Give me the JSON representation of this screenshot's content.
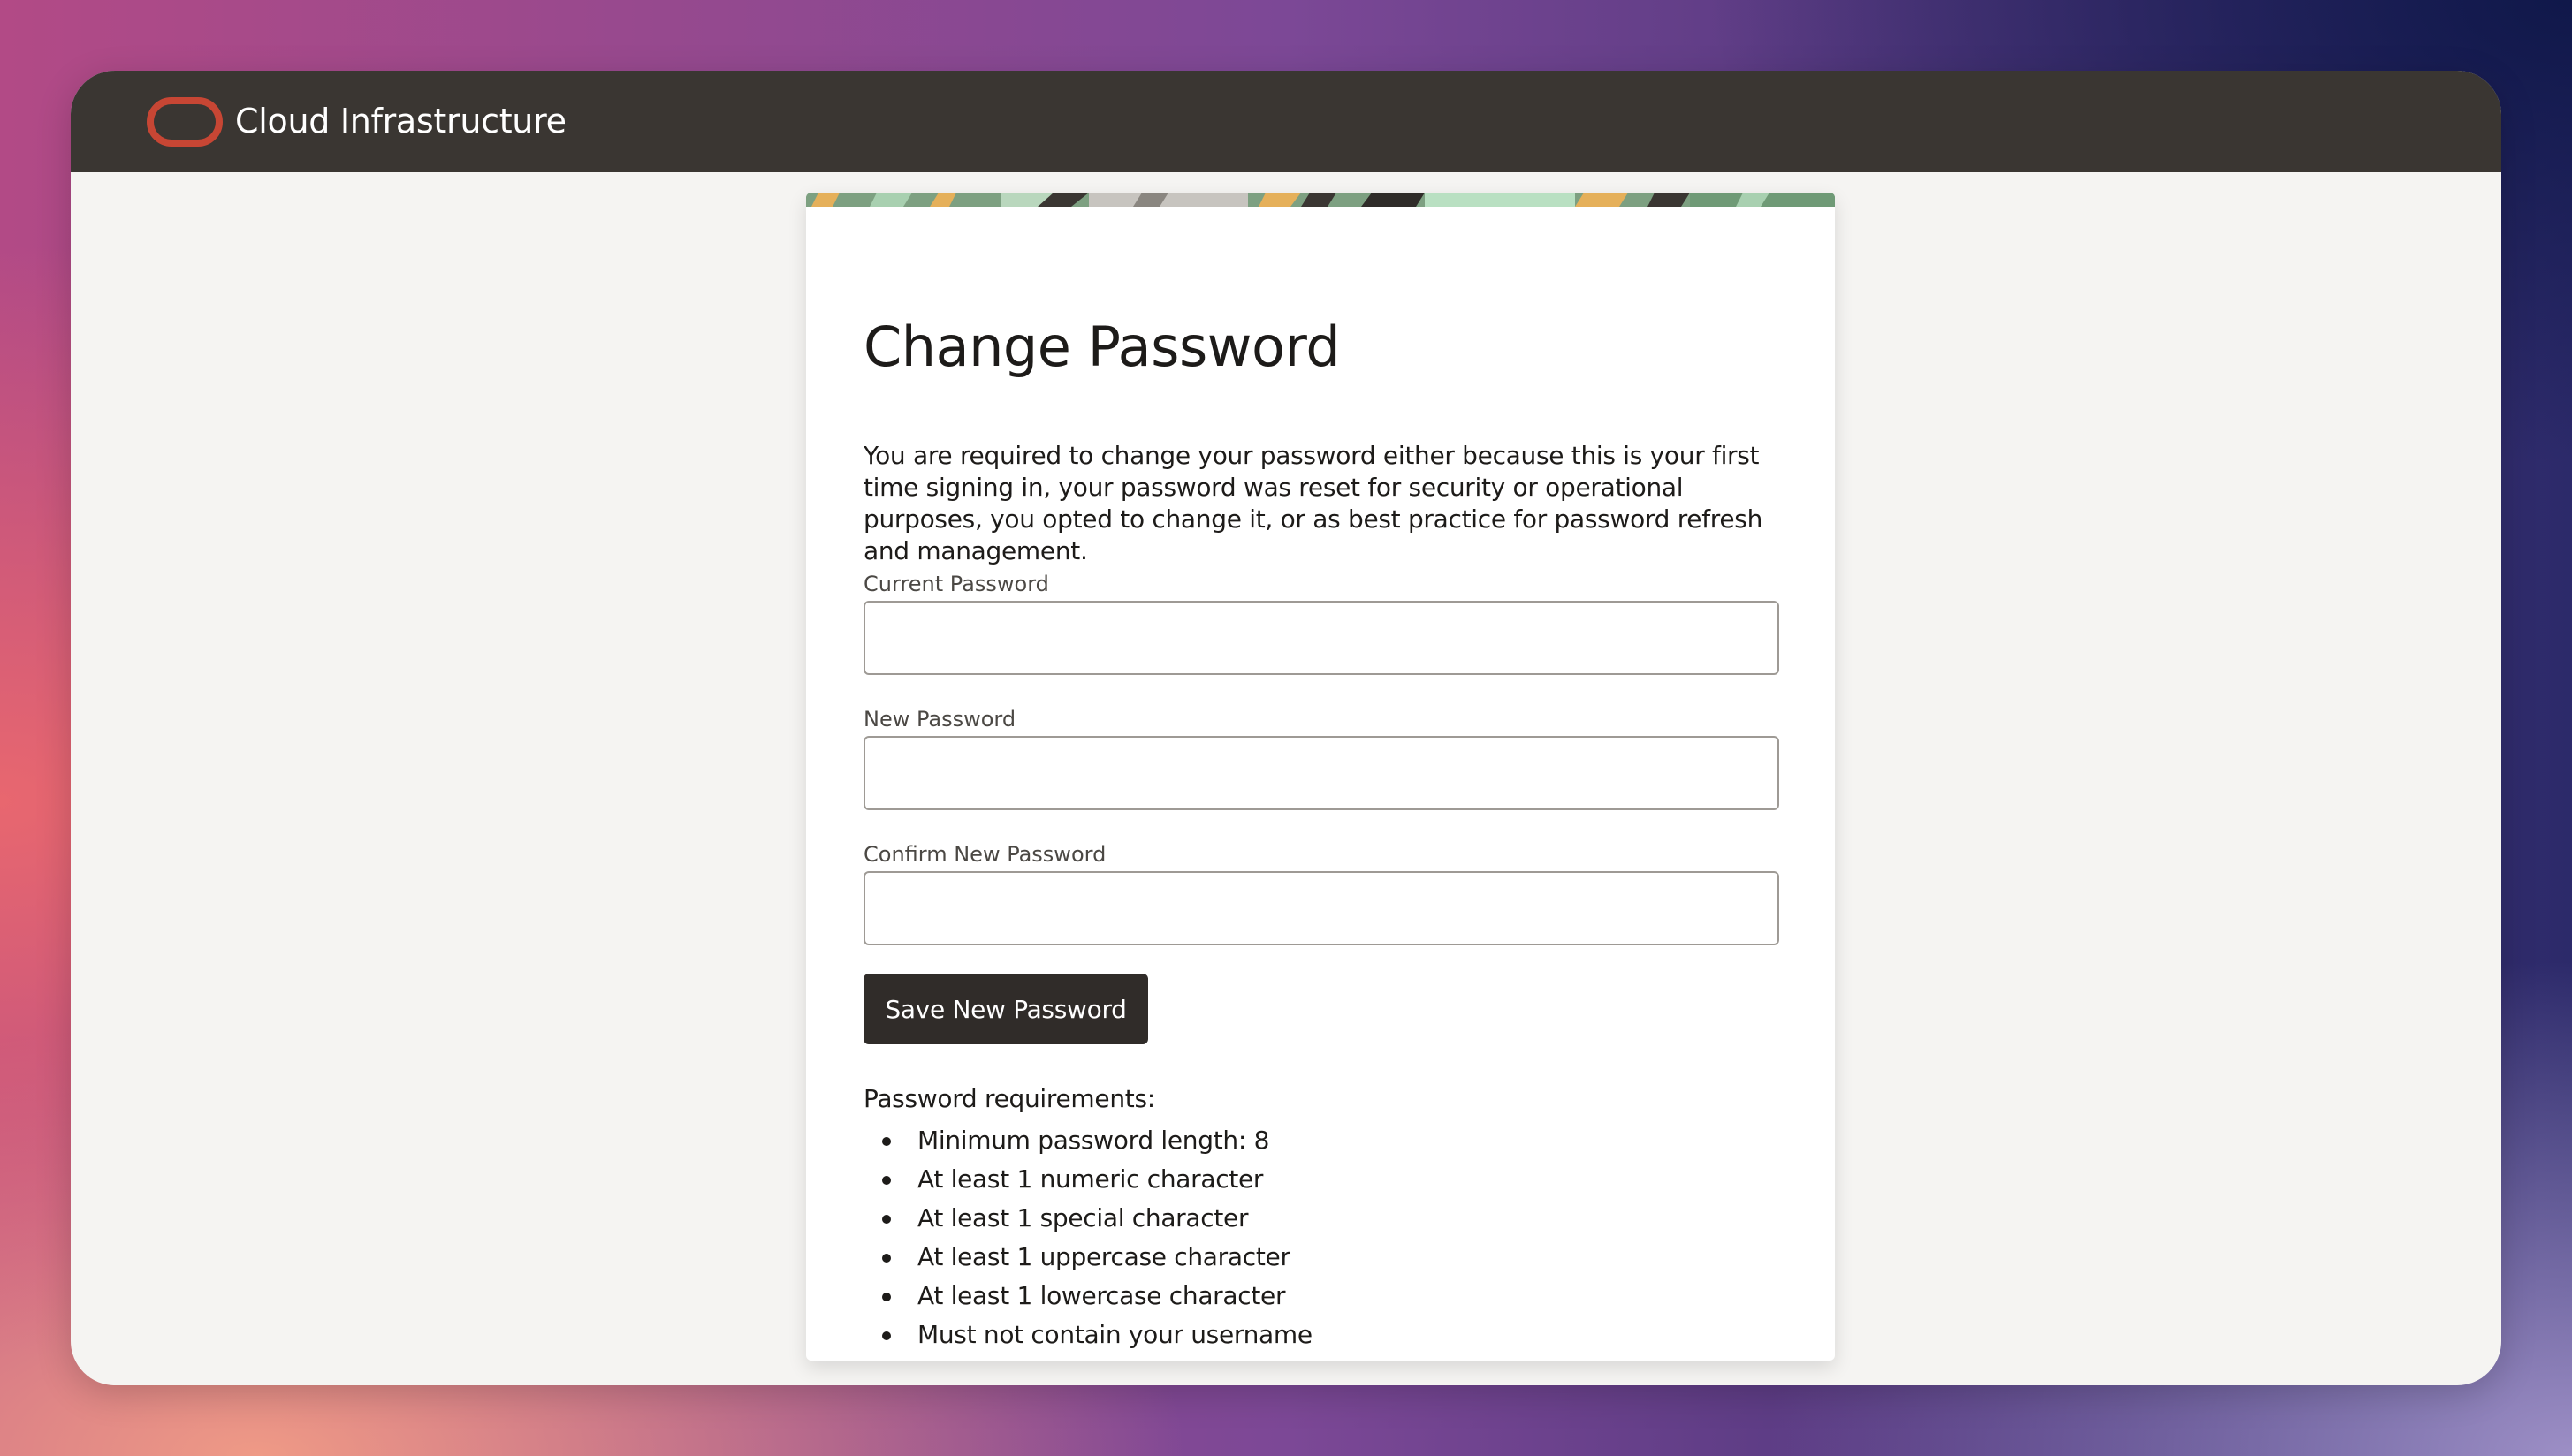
{
  "header": {
    "logo_icon": "oracle-logo-icon",
    "brand": "Cloud Infrastructure",
    "logo_color": "#c74634",
    "bar_color": "#3a3632"
  },
  "card": {
    "title": "Change Password",
    "description": "You are required to change your password either because this is your first time signing in, your password was reset for security or operational purposes, you opted to change it, or as best practice for password refresh and management.",
    "fields": [
      {
        "label": "Current Password",
        "value": "",
        "placeholder": ""
      },
      {
        "label": "New Password",
        "value": "",
        "placeholder": ""
      },
      {
        "label": "Confirm New Password",
        "value": "",
        "placeholder": ""
      }
    ],
    "save_label": "Save New Password",
    "requirements_title": "Password requirements:",
    "requirements": [
      "Minimum password length: 8",
      "At least 1 numeric character",
      "At least 1 special character",
      "At least 1 uppercase character",
      "At least 1 lowercase character",
      "Must not contain your username"
    ]
  }
}
